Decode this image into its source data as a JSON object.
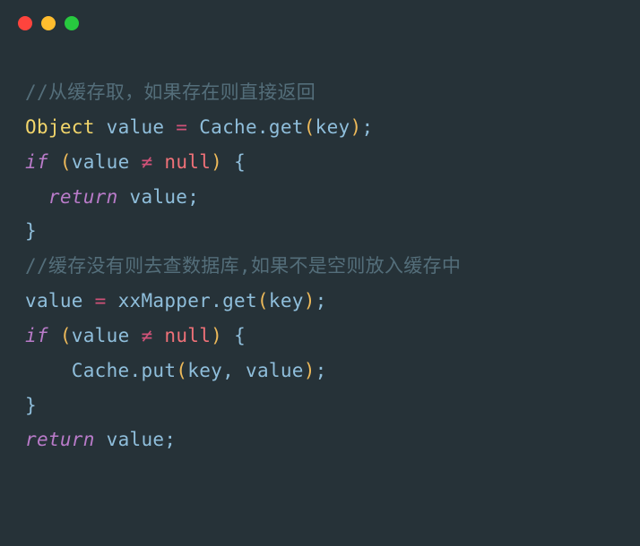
{
  "window": {
    "dots": [
      "red",
      "yellow",
      "green"
    ]
  },
  "code": {
    "lines": [
      {
        "indent": "",
        "segments": [
          {
            "cls": "comment",
            "text": "//从缓存取，如果存在则直接返回"
          }
        ]
      },
      {
        "indent": "",
        "segments": [
          {
            "cls": "type",
            "text": "Object"
          },
          {
            "cls": "plain",
            "text": " "
          },
          {
            "cls": "identifier",
            "text": "value"
          },
          {
            "cls": "plain",
            "text": " "
          },
          {
            "cls": "operator",
            "text": "="
          },
          {
            "cls": "plain",
            "text": " "
          },
          {
            "cls": "identifier",
            "text": "Cache"
          },
          {
            "cls": "punct",
            "text": "."
          },
          {
            "cls": "method",
            "text": "get"
          },
          {
            "cls": "punct-round",
            "text": "("
          },
          {
            "cls": "identifier",
            "text": "key"
          },
          {
            "cls": "punct-round",
            "text": ")"
          },
          {
            "cls": "punct",
            "text": ";"
          }
        ]
      },
      {
        "indent": "",
        "segments": [
          {
            "cls": "keyword",
            "text": "if"
          },
          {
            "cls": "plain",
            "text": " "
          },
          {
            "cls": "punct-round",
            "text": "("
          },
          {
            "cls": "identifier",
            "text": "value"
          },
          {
            "cls": "plain",
            "text": " "
          },
          {
            "cls": "operator",
            "text": "≠"
          },
          {
            "cls": "plain",
            "text": " "
          },
          {
            "cls": "null-lit",
            "text": "null"
          },
          {
            "cls": "punct-round",
            "text": ")"
          },
          {
            "cls": "plain",
            "text": " "
          },
          {
            "cls": "punct",
            "text": "{"
          }
        ]
      },
      {
        "indent": "  ",
        "segments": [
          {
            "cls": "keyword",
            "text": "return"
          },
          {
            "cls": "plain",
            "text": " "
          },
          {
            "cls": "identifier",
            "text": "value"
          },
          {
            "cls": "punct",
            "text": ";"
          }
        ]
      },
      {
        "indent": "",
        "segments": [
          {
            "cls": "punct",
            "text": "}"
          }
        ]
      },
      {
        "indent": "",
        "segments": [
          {
            "cls": "comment",
            "text": "//缓存没有则去查数据库,如果不是空则放入缓存中"
          }
        ]
      },
      {
        "indent": "",
        "segments": [
          {
            "cls": "identifier",
            "text": "value"
          },
          {
            "cls": "plain",
            "text": " "
          },
          {
            "cls": "operator",
            "text": "="
          },
          {
            "cls": "plain",
            "text": " "
          },
          {
            "cls": "identifier",
            "text": "xxMapper"
          },
          {
            "cls": "punct",
            "text": "."
          },
          {
            "cls": "method",
            "text": "get"
          },
          {
            "cls": "punct-round",
            "text": "("
          },
          {
            "cls": "identifier",
            "text": "key"
          },
          {
            "cls": "punct-round",
            "text": ")"
          },
          {
            "cls": "punct",
            "text": ";"
          }
        ]
      },
      {
        "indent": "",
        "segments": [
          {
            "cls": "keyword",
            "text": "if"
          },
          {
            "cls": "plain",
            "text": " "
          },
          {
            "cls": "punct-round",
            "text": "("
          },
          {
            "cls": "identifier",
            "text": "value"
          },
          {
            "cls": "plain",
            "text": " "
          },
          {
            "cls": "operator",
            "text": "≠"
          },
          {
            "cls": "plain",
            "text": " "
          },
          {
            "cls": "null-lit",
            "text": "null"
          },
          {
            "cls": "punct-round",
            "text": ")"
          },
          {
            "cls": "plain",
            "text": " "
          },
          {
            "cls": "punct",
            "text": "{"
          }
        ]
      },
      {
        "indent": "    ",
        "segments": [
          {
            "cls": "identifier",
            "text": "Cache"
          },
          {
            "cls": "punct",
            "text": "."
          },
          {
            "cls": "method",
            "text": "put"
          },
          {
            "cls": "punct-round",
            "text": "("
          },
          {
            "cls": "identifier",
            "text": "key"
          },
          {
            "cls": "punct",
            "text": ","
          },
          {
            "cls": "plain",
            "text": " "
          },
          {
            "cls": "identifier",
            "text": "value"
          },
          {
            "cls": "punct-round",
            "text": ")"
          },
          {
            "cls": "punct",
            "text": ";"
          }
        ]
      },
      {
        "indent": "",
        "segments": [
          {
            "cls": "punct",
            "text": "}"
          }
        ]
      },
      {
        "indent": "",
        "segments": [
          {
            "cls": "keyword",
            "text": "return"
          },
          {
            "cls": "plain",
            "text": " "
          },
          {
            "cls": "identifier",
            "text": "value"
          },
          {
            "cls": "punct",
            "text": ";"
          }
        ]
      }
    ]
  }
}
